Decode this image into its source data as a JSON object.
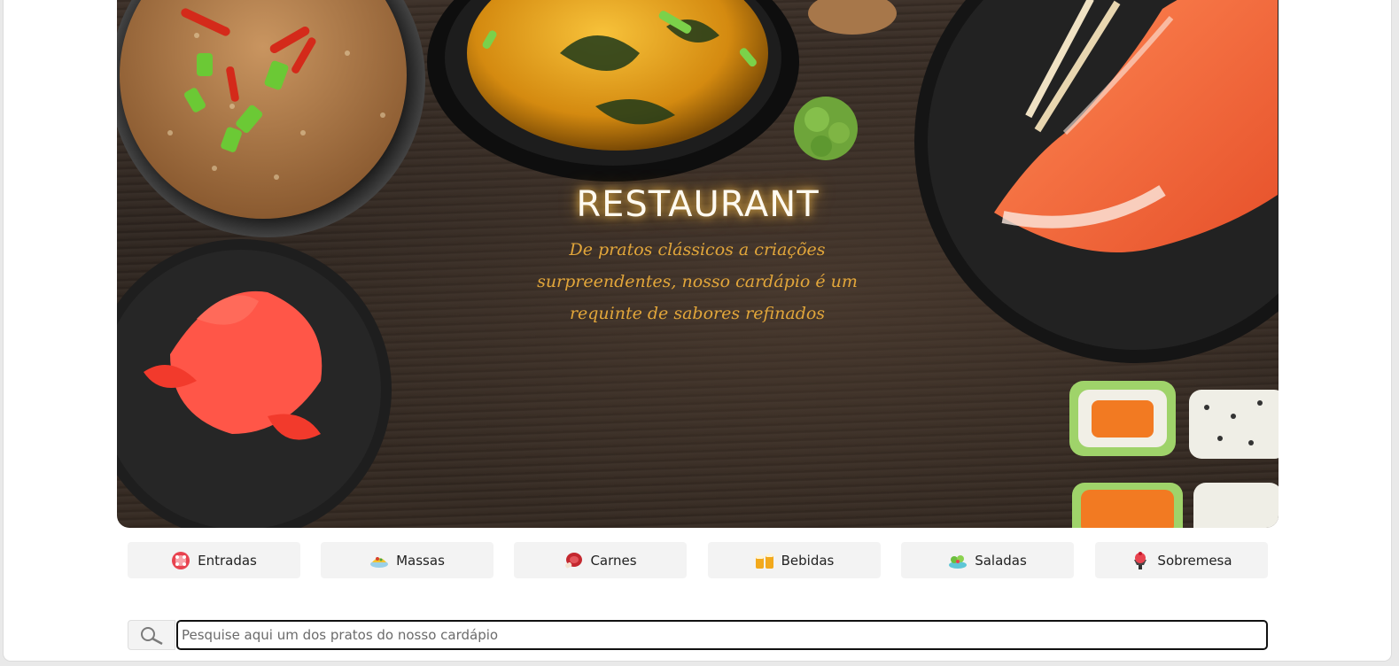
{
  "hero": {
    "title": "RESTAURANT",
    "subtitle": "De pratos clássicos a criações surpreendentes, nosso cardápio é um requinte de sabores refinados"
  },
  "categories": [
    {
      "label": "Entradas",
      "icon": "appetizer-icon"
    },
    {
      "label": "Massas",
      "icon": "pasta-icon"
    },
    {
      "label": "Carnes",
      "icon": "meat-icon"
    },
    {
      "label": "Bebidas",
      "icon": "drinks-icon"
    },
    {
      "label": "Saladas",
      "icon": "salad-icon"
    },
    {
      "label": "Sobremesa",
      "icon": "dessert-icon"
    }
  ],
  "search": {
    "placeholder": "Pesquise aqui um dos pratos do nosso cardápio",
    "value": "",
    "icon": "search-icon"
  },
  "colors": {
    "title_glow": "#ffc850",
    "subtitle": "#e2a63a",
    "category_bg": "#f3f3f3"
  }
}
